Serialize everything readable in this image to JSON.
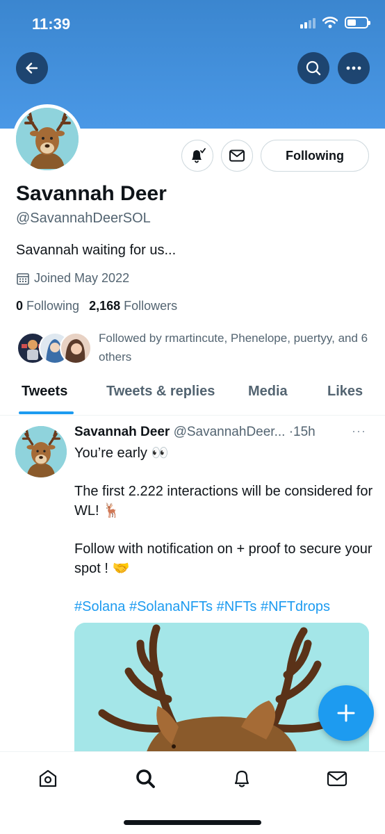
{
  "status_bar": {
    "time": "11:39"
  },
  "header": {
    "back_icon": "arrow-left-icon",
    "search_icon": "search-icon",
    "more_icon": "more-horizontal-icon",
    "banner_color": "#4a98e6"
  },
  "profile": {
    "name": "Savannah Deer",
    "handle": "@SavannahDeerSOL",
    "bio": "Savannah waiting for us...",
    "joined": "Joined May 2022",
    "following_count": "0",
    "following_label": "Following",
    "followers_count": "2,168",
    "followers_label": "Followers",
    "followed_by": "Followed by rmartincute, Phenelope, puertyy, and 6 others",
    "following_button": "Following",
    "notify_icon": "bell-check-icon",
    "message_icon": "mail-icon"
  },
  "tabs": [
    {
      "label": "Tweets",
      "active": true
    },
    {
      "label": "Tweets & replies",
      "active": false
    },
    {
      "label": "Media",
      "active": false
    },
    {
      "label": "Likes",
      "active": false
    }
  ],
  "tweet": {
    "author_name": "Savannah Deer",
    "author_handle": "@SavannahDeer...",
    "separator": "·",
    "time": "15h",
    "more": "···",
    "line1": "You’re early 👀",
    "line2": "The first 2.222 interactions will be considered for WL! 🦌",
    "line3": "Follow with notification on + proof to secure your spot ! 🤝",
    "hashtags": [
      "#Solana",
      "#SolanaNFTs",
      "#NFTs",
      "#NFTdrops"
    ]
  },
  "fab": {
    "icon": "plus-icon"
  },
  "bottom_nav": [
    {
      "icon": "home-icon"
    },
    {
      "icon": "search-icon"
    },
    {
      "icon": "bell-icon"
    },
    {
      "icon": "mail-icon"
    }
  ],
  "colors": {
    "accent": "#1d9bf0",
    "text": "#0f1419",
    "muted": "#536471"
  }
}
